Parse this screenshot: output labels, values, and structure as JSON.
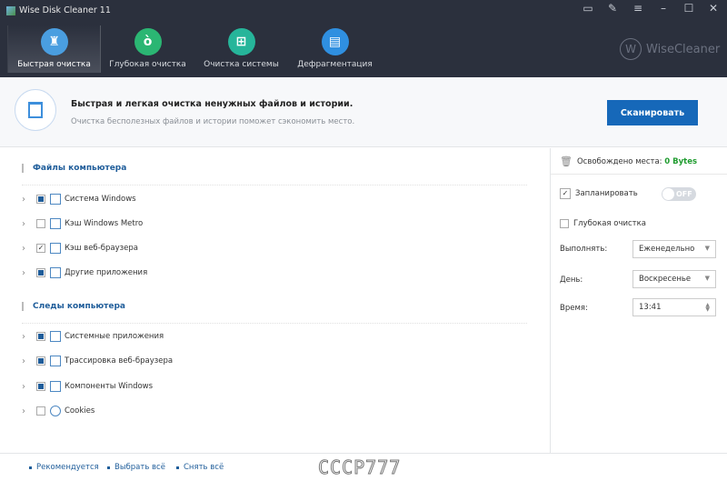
{
  "app": {
    "title": "Wise Disk Cleaner 11",
    "logo": "WiseCleaner"
  },
  "window_controls": [
    "feedback-icon",
    "notes-icon",
    "menu-icon",
    "minimize-icon",
    "maximize-icon",
    "close-icon"
  ],
  "tabs": [
    {
      "label": "Быстрая очистка",
      "icon": "broom-icon",
      "color": "#4a9ee0"
    },
    {
      "label": "Глубокая очистка",
      "icon": "vacuum-icon",
      "color": "#2bb673"
    },
    {
      "label": "Очистка системы",
      "icon": "windows-icon",
      "color": "#26b59a"
    },
    {
      "label": "Дефрагментация",
      "icon": "disk-icon",
      "color": "#2f8fe0"
    }
  ],
  "header": {
    "title": "Быстрая и легкая очистка ненужных файлов и истории.",
    "subtitle": "Очистка бесполезных файлов и истории поможет сэкономить место.",
    "scan_label": "Сканировать"
  },
  "sections": [
    {
      "title": "Файлы компьютера",
      "items": [
        {
          "label": "Система Windows",
          "state": "partial"
        },
        {
          "label": "Кэш Windows Metro",
          "state": "unchecked"
        },
        {
          "label": "Кэш веб-браузера",
          "state": "checked"
        },
        {
          "label": "Другие приложения",
          "state": "partial"
        }
      ]
    },
    {
      "title": "Следы компьютера",
      "items": [
        {
          "label": "Системные приложения",
          "state": "partial"
        },
        {
          "label": "Трассировка веб-браузера",
          "state": "partial"
        },
        {
          "label": "Компоненты Windows",
          "state": "partial"
        },
        {
          "label": "Cookies",
          "state": "unchecked"
        }
      ]
    }
  ],
  "right": {
    "freed_label": "Освобождено места:",
    "freed_value": "0 Bytes",
    "schedule_label": "Запланировать",
    "toggle": "OFF",
    "deep_label": "Глубокая очистка",
    "run_label": "Выполнять:",
    "run_value": "Еженедельно",
    "day_label": "День:",
    "day_value": "Воскресенье",
    "time_label": "Время:",
    "time_value": "13:41"
  },
  "footer": {
    "recommended": "Рекомендуется",
    "select_all": "Выбрать всё",
    "deselect_all": "Снять всё",
    "watermark": "СССР777"
  }
}
